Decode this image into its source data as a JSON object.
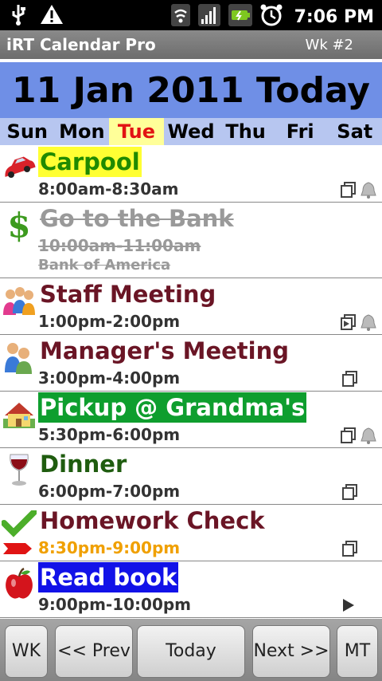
{
  "status": {
    "time": "7:06 PM"
  },
  "app": {
    "title": "iRT Calendar Pro",
    "week": "Wk #2"
  },
  "header": {
    "date": "11 Jan 2011 Today"
  },
  "days": [
    "Sun",
    "Mon",
    "Tue",
    "Wed",
    "Thu",
    "Fri",
    "Sat"
  ],
  "events": [
    {
      "title": "Carpool",
      "time": "8:00am-8:30am",
      "icon": "car-icon"
    },
    {
      "title": "Go to the Bank",
      "time": "10:00am-11:00am",
      "location": "Bank of America",
      "icon": "dollar-icon"
    },
    {
      "title": "Staff Meeting",
      "time": "1:00pm-2:00pm",
      "icon": "people-icon"
    },
    {
      "title": "Manager's Meeting",
      "time": "3:00pm-4:00pm",
      "icon": "people-icon"
    },
    {
      "title": "Pickup @ Grandma's",
      "time": "5:30pm-6:00pm",
      "icon": "house-icon"
    },
    {
      "title": "Dinner",
      "time": "6:00pm-7:00pm",
      "icon": "wine-icon"
    },
    {
      "title": "Homework Check",
      "time": "8:30pm-9:00pm",
      "icon": "checkmark-icon"
    },
    {
      "title": "Read book",
      "time": "9:00pm-10:00pm",
      "icon": "apple-icon"
    }
  ],
  "buttons": {
    "wk": "WK",
    "prev": "<< Prev",
    "today": "Today",
    "next": "Next >>",
    "mt": "MT"
  }
}
